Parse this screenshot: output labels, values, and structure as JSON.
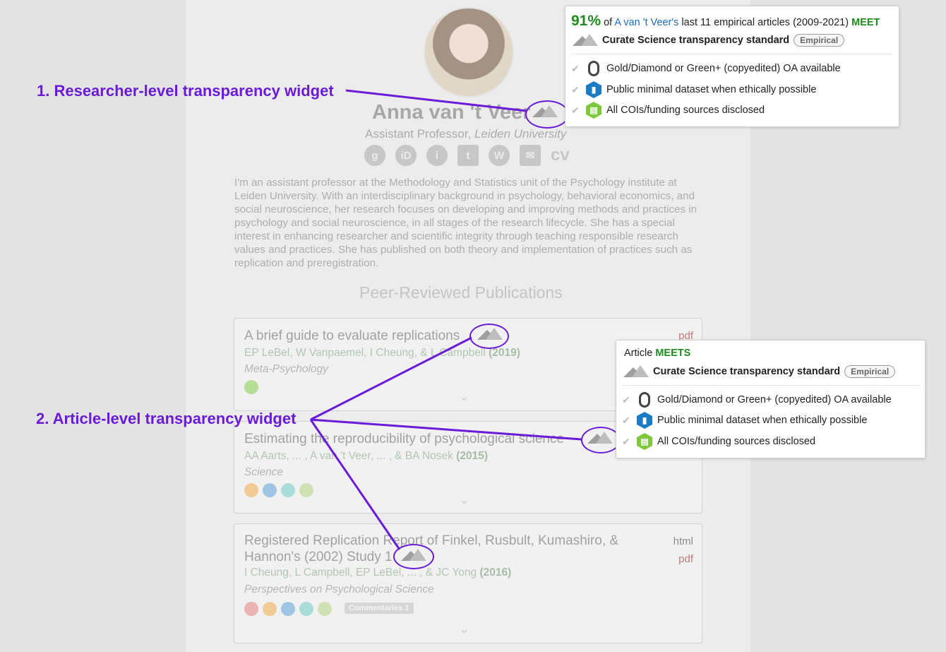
{
  "profile": {
    "name": "Anna van 't Veer",
    "role": "Assistant Professor,",
    "institution": "Leiden University",
    "social": [
      "g",
      "iD",
      "i",
      "twitter",
      "wordpress",
      "email",
      "cv"
    ],
    "cv_label": "cv",
    "bio": "I'm an assistant professor at the Methodology and Statistics unit of the Psychology institute at Leiden University. With an interdisciplinary background in psychology, behavioral economics, and social neuroscience, her research focuses on developing and improving methods and practices in psychology and social neuroscience, in all stages of the research lifecycle. She has a special interest in enhancing researcher and scientific integrity through teaching responsible research values and practices. She has published on both theory and implementation of practices such as replication and preregistration."
  },
  "section": {
    "title": "Peer-Reviewed Publications"
  },
  "publications": [
    {
      "title": "A brief guide to evaluate replications",
      "authors": "EP LeBel, W Vanpaemel, I Cheung, & L Campbell",
      "year": "(2019)",
      "journal": "Meta-Psychology",
      "links": [
        "pdf"
      ]
    },
    {
      "title": "Estimating the reproducibility of psychological science",
      "authors": "AA Aarts, ... , A van 't Veer, ... , & BA Nosek",
      "year": "(2015)",
      "journal": "Science",
      "links": []
    },
    {
      "title": "Registered Replication Report of Finkel, Rusbult, Kumashiro, & Hannon's (2002) Study 1",
      "authors": "I Cheung, L Campbell, EP LeBel, ... , & JC Yong",
      "year": "(2016)",
      "journal": "Perspectives on Psychological Science",
      "links": [
        "html",
        "pdf"
      ],
      "commentaries": "Commentaries",
      "commentaries_count": "1"
    }
  ],
  "researcher_popup": {
    "percent": "91%",
    "of": "of",
    "researcher": "A van 't Veer's",
    "rest": "last 11 empirical articles (2009-2021)",
    "verdict": "MEET",
    "standard": "Curate Science transparency standard",
    "pill": "Empirical",
    "items": [
      "Gold/Diamond or Green+ (copyedited) OA available",
      "Public minimal dataset when ethically possible",
      "All COIs/funding sources disclosed"
    ]
  },
  "article_popup": {
    "prefix": "Article",
    "verdict": "MEETS",
    "standard": "Curate Science transparency standard",
    "pill": "Empirical",
    "items": [
      "Gold/Diamond or Green+ (copyedited) OA available",
      "Public minimal dataset when ethically possible",
      "All COIs/funding sources disclosed"
    ]
  },
  "annotations": {
    "label1": "1. Researcher-level transparency widget",
    "label2": "2. Article-level transparency widget",
    "color": "#6a1bd8"
  },
  "colors": {
    "meet_green": "#1f8a1f",
    "link_blue": "#1e6fb8",
    "annotation_purple": "#6a1bd8"
  }
}
